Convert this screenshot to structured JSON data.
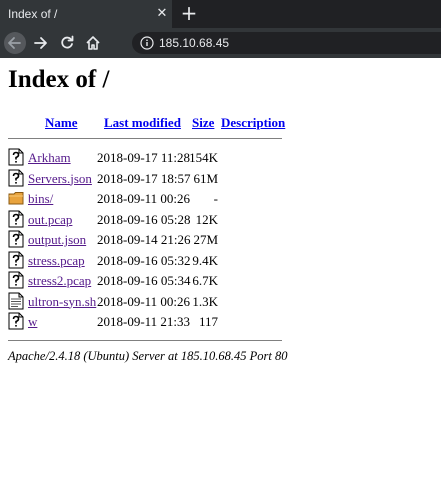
{
  "browser": {
    "tab_title": "Index of /",
    "tab_close": "✕",
    "new_tab": "+",
    "url": "185.10.68.45"
  },
  "page": {
    "heading": "Index of /",
    "columns": {
      "name": "Name",
      "last_modified": "Last modified",
      "size": "Size",
      "description": "Description"
    },
    "files": [
      {
        "name": "Arkham",
        "modified": "2018-09-17 11:28",
        "size": "154K",
        "icon": "unknown-file-icon"
      },
      {
        "name": "Servers.json",
        "modified": "2018-09-17 18:57",
        "size": "61M",
        "icon": "unknown-file-icon"
      },
      {
        "name": "bins/",
        "modified": "2018-09-11 00:26",
        "size": "-",
        "icon": "folder-icon"
      },
      {
        "name": "out.pcap",
        "modified": "2018-09-16 05:28",
        "size": "12K",
        "icon": "unknown-file-icon"
      },
      {
        "name": "output.json",
        "modified": "2018-09-14 21:26",
        "size": "27M",
        "icon": "unknown-file-icon"
      },
      {
        "name": "stress.pcap",
        "modified": "2018-09-16 05:32",
        "size": "9.4K",
        "icon": "unknown-file-icon"
      },
      {
        "name": "stress2.pcap",
        "modified": "2018-09-16 05:34",
        "size": "6.7K",
        "icon": "unknown-file-icon"
      },
      {
        "name": "ultron-syn.sh",
        "modified": "2018-09-11 00:26",
        "size": "1.3K",
        "icon": "text-file-icon"
      },
      {
        "name": "w",
        "modified": "2018-09-11 21:33",
        "size": "117",
        "icon": "unknown-file-icon"
      }
    ],
    "footer": "Apache/2.4.18 (Ubuntu) Server at 185.10.68.45 Port 80"
  },
  "colors": {
    "chrome_dark": "#202124",
    "chrome_tab": "#323639",
    "link": "#0000ee",
    "visited_link": "#551a8b",
    "folder": "#e8a33d"
  }
}
